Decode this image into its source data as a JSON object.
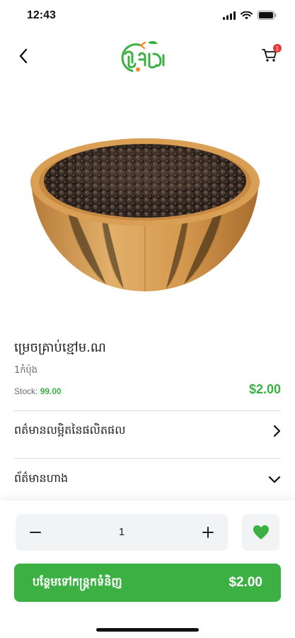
{
  "status_bar": {
    "time": "12:43",
    "icons": [
      "signal-icon",
      "wifi-icon",
      "battery-icon"
    ]
  },
  "nav": {
    "back_icon": "chevron-left-icon",
    "logo_text": "ផ្សារខ្មែរ",
    "cart_icon": "cart-icon",
    "cart_count": "1"
  },
  "product": {
    "name": "ម្រេចគ្រាប់ខ្មៅម.ណ",
    "unit": "1កំប៉ុង",
    "stock_label": "Stock:",
    "stock_value": "99.00",
    "price": "$2.00"
  },
  "sections": [
    {
      "title": "ពត៌មានលម្អិតនៃផលិតផល",
      "icon": "chevron-right-icon"
    },
    {
      "title": "ព័ត៌មានហាង",
      "icon": "chevron-down-icon"
    }
  ],
  "cart_panel": {
    "quantity": "1",
    "minus_icon": "minus-icon",
    "plus_icon": "plus-icon",
    "favorite_icon": "heart-icon",
    "add_to_cart_label": "បន្ថែមទៅកន្ត្រកទំនិញ",
    "total_price": "$2.00"
  },
  "colors": {
    "accent": "#3cb043",
    "badge": "#e53935",
    "panel_bg": "#f2f3f5"
  }
}
